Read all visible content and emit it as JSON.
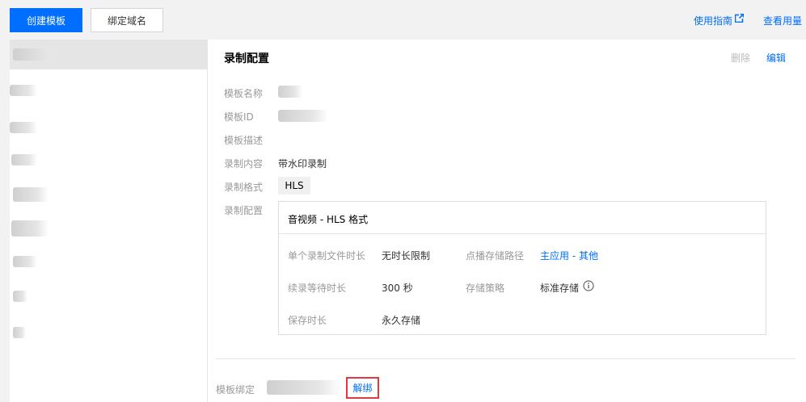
{
  "toolbar": {
    "create_template": "创建模板",
    "bind_domain": "绑定域名",
    "guide": "使用指南",
    "guide_icon": "external-link-icon",
    "usage": "查看用量"
  },
  "detail": {
    "section_title": "录制配置",
    "actions": {
      "delete": "删除",
      "edit": "编辑"
    },
    "fields": {
      "template_name_label": "模板名称",
      "template_id_label": "模板ID",
      "template_desc_label": "模板描述",
      "record_content_label": "录制内容",
      "record_content_value": "带水印录制",
      "record_format_label": "录制格式",
      "record_format_value": "HLS",
      "record_config_label": "录制配置"
    },
    "config": {
      "header": "音视频 - HLS 格式",
      "single_file_duration_label": "单个录制文件时长",
      "single_file_duration_value": "无时长限制",
      "vod_storage_path_label": "点播存储路径",
      "vod_storage_path_value": "主应用 - 其他",
      "resume_wait_label": "续录等待时长",
      "resume_wait_value": "300 秒",
      "storage_policy_label": "存储策略",
      "storage_policy_value": "标准存储",
      "storage_policy_icon": "info-circle-icon",
      "retention_label": "保存时长",
      "retention_value": "永久存储"
    },
    "binding": {
      "label": "模板绑定",
      "unbind": "解绑"
    }
  },
  "colors": {
    "primary": "#006eff",
    "highlight_border": "#e0393e",
    "disabled_text": "#b9b9b9"
  }
}
